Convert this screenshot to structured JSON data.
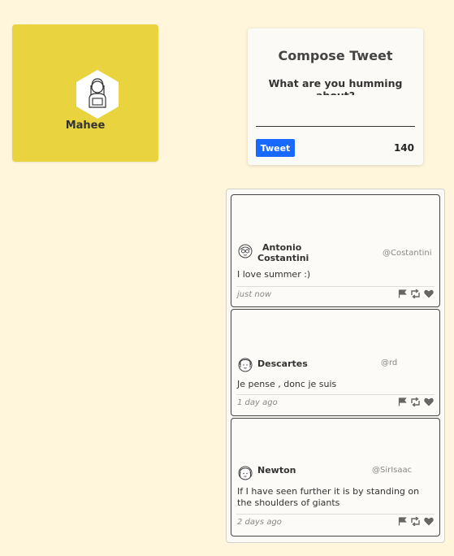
{
  "profile": {
    "name": "Mahee",
    "avatar_icon": "user-hexagon-avatar",
    "card_color": "#e9d43f"
  },
  "compose": {
    "title": "Compose Tweet",
    "question": "What are you humming about?",
    "input_value": "",
    "button_label": "Tweet",
    "char_count": "140",
    "button_color": "#1769ff"
  },
  "tweets": [
    {
      "author": "Antonio Costantini",
      "author_line1": "Antonio",
      "author_line2": "Costantini",
      "handle": "@Costantini",
      "content": "I love summer :)",
      "time": "just now",
      "avatar_icon": "glasses-avatar-icon"
    },
    {
      "author": "Descartes",
      "handle": "@rd",
      "content": "Je pense , donc je suis",
      "time": "1 day ago",
      "avatar_icon": "curly-hair-avatar-icon"
    },
    {
      "author": "Newton",
      "handle": "@SirIsaac",
      "content": "If I have seen further it is by standing on the shoulders of giants",
      "time": "2 days ago",
      "avatar_icon": "wig-avatar-icon"
    }
  ],
  "action_icons": [
    "flag-icon",
    "retweet-icon",
    "heart-icon"
  ]
}
